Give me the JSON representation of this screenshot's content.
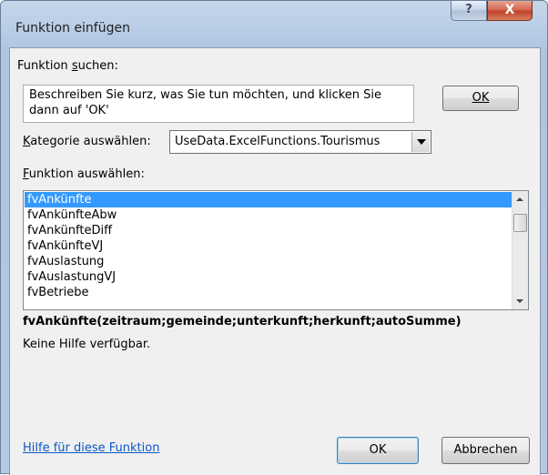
{
  "window": {
    "title": "Funktion einfügen",
    "help_button": "?",
    "close_button": "X"
  },
  "search": {
    "label": "Funktion suchen:",
    "label_parts": [
      "Funktion ",
      "s",
      "uchen:"
    ],
    "description": "Beschreiben Sie kurz, was Sie tun möchten, und klicken Sie dann auf 'OK'",
    "ok_button": "OK"
  },
  "category": {
    "label_parts": [
      "K",
      "ategorie auswählen:"
    ],
    "selected": "UseData.ExcelFunctions.Tourismus"
  },
  "function_list": {
    "label_parts": [
      "F",
      "unktion auswählen:"
    ],
    "items": [
      "fvAnkünfte",
      "fvAnkünfteAbw",
      "fvAnkünfteDiff",
      "fvAnkünfteVJ",
      "fvAuslastung",
      "fvAuslastungVJ",
      "fvBetriebe"
    ],
    "selected_index": 0
  },
  "details": {
    "signature": "fvAnkünfte(zeitraum;gemeinde;unterkunft;herkunft;autoSumme)",
    "help_text": "Keine Hilfe verfügbar."
  },
  "footer": {
    "help_link": "Hilfe für diese Funktion",
    "ok_button": "OK",
    "cancel_button": "Abbrechen"
  },
  "colors": {
    "selection": "#3399ff",
    "link": "#0b58c6",
    "close": "#c1432a"
  }
}
